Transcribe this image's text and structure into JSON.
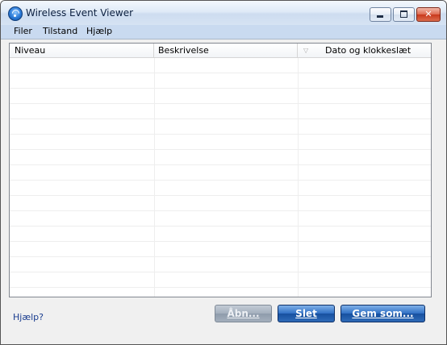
{
  "window": {
    "title": "Wireless Event Viewer",
    "app_icon": "wireless-icon"
  },
  "controls": {
    "close_glyph": "✕"
  },
  "menu": {
    "items": [
      "Filer",
      "Tilstand",
      "Hjælp"
    ]
  },
  "table": {
    "columns": [
      "Niveau",
      "Beskrivelse",
      "Dato og klokkeslæt"
    ],
    "sort_glyph": "▽",
    "rows": []
  },
  "footer": {
    "help_link": "Hjælp?",
    "open_button": "Åbn...",
    "delete_button": "Slet",
    "save_button": "Gem som..."
  }
}
